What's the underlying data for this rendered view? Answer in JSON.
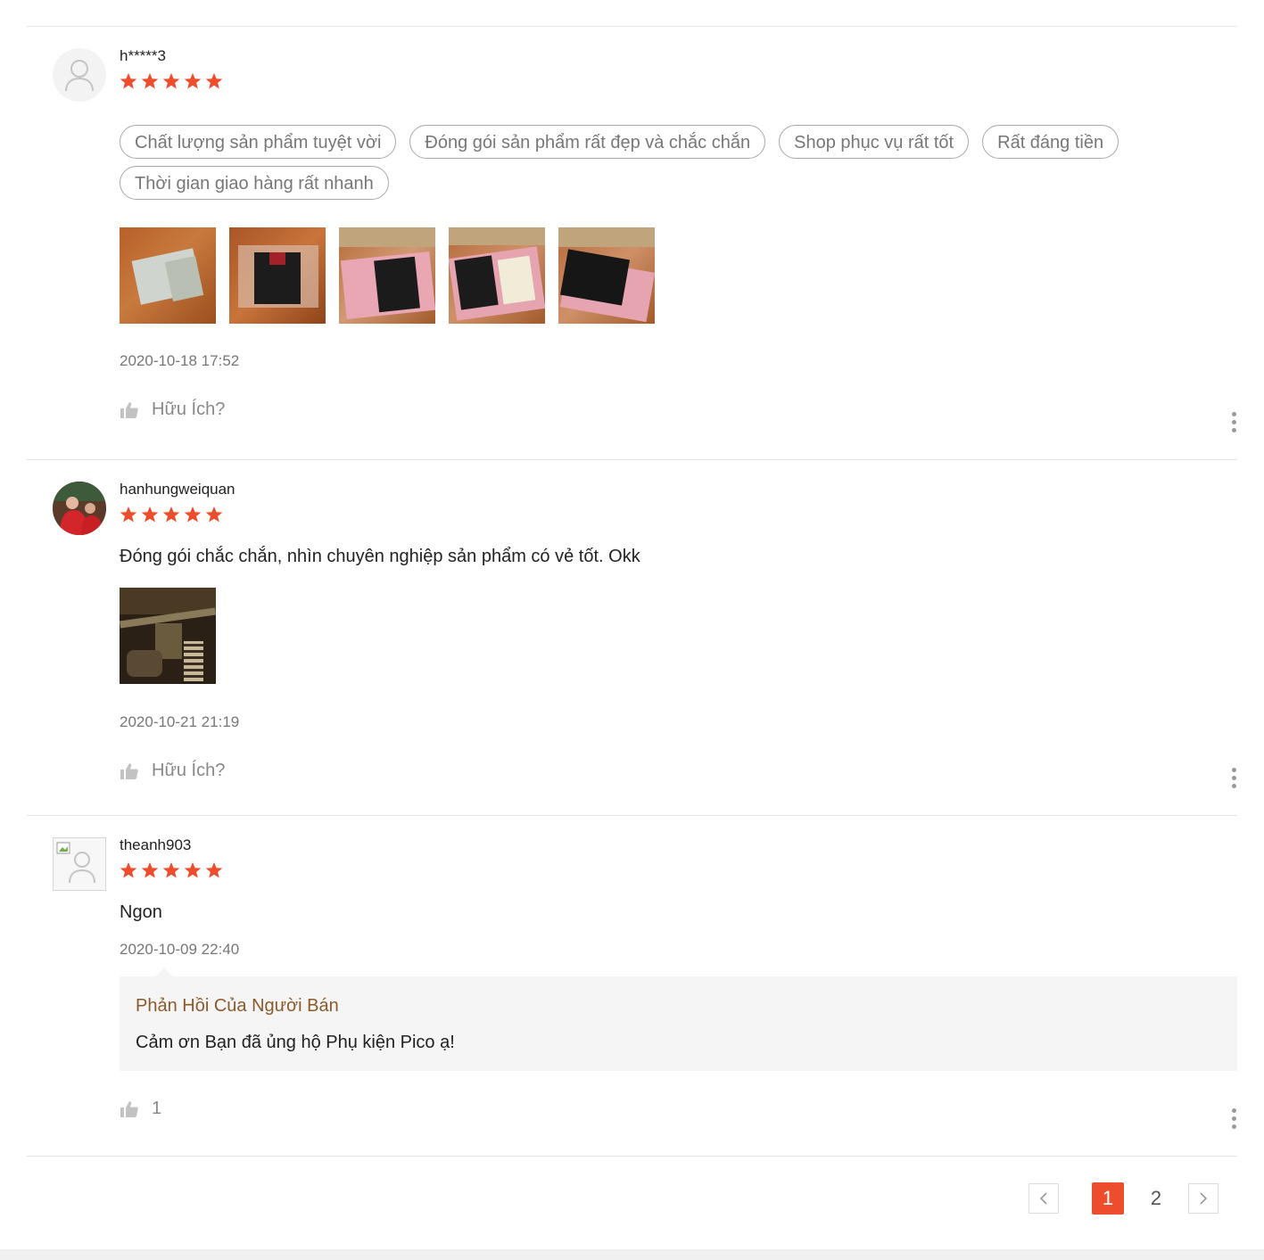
{
  "reviews": [
    {
      "username": "h*****3",
      "rating": 5,
      "avatar": "person-placeholder-icon",
      "tags": [
        "Chất lượng sản phẩm tuyệt vời",
        "Đóng gói sản phẩm rất đẹp và chắc chắn",
        "Shop phục vụ rất tốt",
        "Rất đáng tiền",
        "Thời gian giao hàng rất nhanh"
      ],
      "date": "2020-10-18 17:52",
      "helpful_label": "Hữu Ích?"
    },
    {
      "username": "hanhungweiquan",
      "rating": 5,
      "avatar": "user-photo",
      "comment": "Đóng gói chắc chắn, nhìn chuyên nghiệp sản phẩm có vẻ tốt. Okk",
      "date": "2020-10-21 21:19",
      "helpful_label": "Hữu Ích?"
    },
    {
      "username": "theanh903",
      "rating": 5,
      "avatar": "broken-image-icon",
      "comment": "Ngon",
      "date": "2020-10-09 22:40",
      "seller_reply": {
        "title": "Phản Hồi Của Người Bán",
        "body": "Cảm ơn Bạn đã ủng hộ Phụ kiện Pico ạ!"
      },
      "helpful_count": "1"
    }
  ],
  "pagination": {
    "pages": [
      "1",
      "2"
    ],
    "current": "1"
  },
  "colors": {
    "star": "#ee4d2d",
    "active_page": "#ee4d2d",
    "reply_title": "#8b5a2b"
  }
}
